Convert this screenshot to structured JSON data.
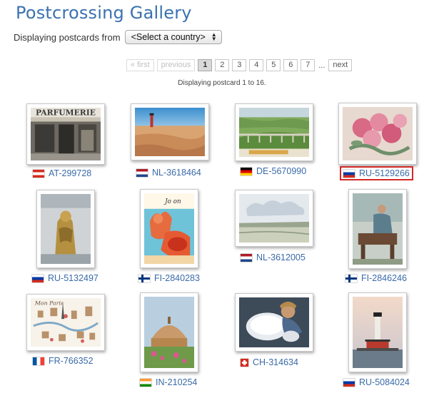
{
  "page": {
    "title": "Postcrossing Gallery"
  },
  "filter": {
    "label": "Displaying postcards from",
    "selected": "<Select a country>"
  },
  "pagination": {
    "first": "« first",
    "previous": "previous",
    "pages": [
      "1",
      "2",
      "3",
      "4",
      "5",
      "6",
      "7"
    ],
    "current": "1",
    "ellipsis": "...",
    "next": "next"
  },
  "status": "Displaying postcard 1 to 16.",
  "postcards": [
    {
      "id": "AT-299728",
      "flag": "austria-flag-icon",
      "image": "parfumerie shop front"
    },
    {
      "id": "NL-3618464",
      "flag": "netherlands-flag-icon",
      "image": "lighthouse sand dunes"
    },
    {
      "id": "DE-5670990",
      "flag": "germany-flag-icon",
      "image": "bridge over green valley"
    },
    {
      "id": "RU-5129266",
      "flag": "russia-flag-icon",
      "image": "pink flowers painting",
      "selected": true
    },
    {
      "id": "RU-5132497",
      "flag": "russia-flag-icon",
      "image": "golden fountain statue"
    },
    {
      "id": "FI-2840283",
      "flag": "finland-flag-icon",
      "image": "cartoon figure at beach"
    },
    {
      "id": "NL-3612005",
      "flag": "netherlands-flag-icon",
      "image": "landscape with clouds watercolor"
    },
    {
      "id": "FI-2846246",
      "flag": "finland-flag-icon",
      "image": "woman at washing tub"
    },
    {
      "id": "FR-766352",
      "flag": "france-flag-icon",
      "image": "Mon Paris illustrated map"
    },
    {
      "id": "IN-210254",
      "flag": "india-flag-icon",
      "image": "stupa with garden"
    },
    {
      "id": "CH-314634",
      "flag": "switzerland-flag-icon",
      "image": "child with sheep"
    },
    {
      "id": "RU-5084024",
      "flag": "russia-flag-icon",
      "image": "lighthouse on pier"
    }
  ],
  "image_text": {
    "fr_map": "Mon Paris",
    "fi_cartoon": "Jo on"
  },
  "colors": {
    "title": "#3a72b0",
    "link": "#3a6aa8",
    "selected_border": "#d32828"
  }
}
